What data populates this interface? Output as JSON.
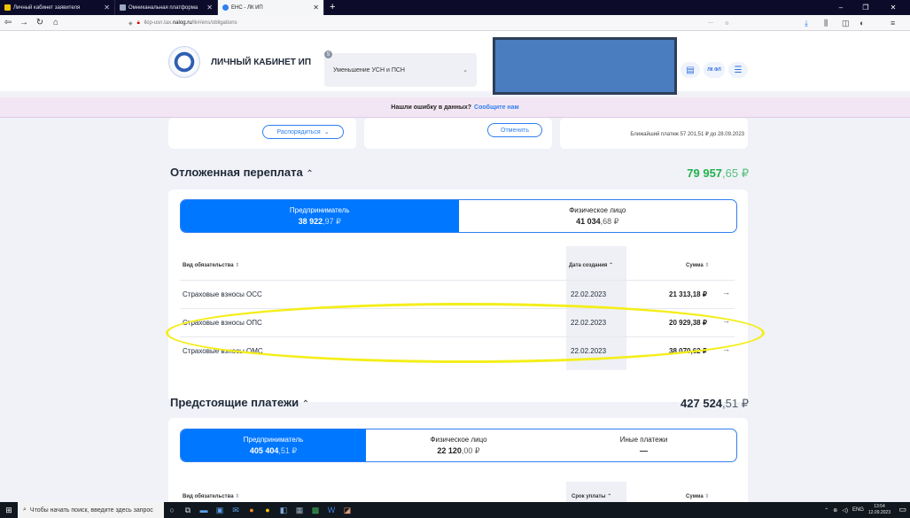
{
  "browser": {
    "tabs": [
      {
        "title": "Личный кабинет заявителя",
        "active": false
      },
      {
        "title": "Омниканальная платформа",
        "active": false
      },
      {
        "title": "ЕНС - ЛК ИП",
        "active": true
      }
    ],
    "new_tab": "+",
    "url_prefix": "lkip-usn.tax.",
    "url_domain": "nalog.ru",
    "url_path": "/lk#/ens/obligations",
    "url_more": "···",
    "window_min": "–",
    "window_max": "❐",
    "window_close": "✕"
  },
  "header": {
    "brand": "ЛИЧНЫЙ КАБИНЕТ ИП",
    "mode_select": "Уменьшение УСН и ПСН",
    "mode_badge": "5",
    "lk_fl": "ЛК ФЛ"
  },
  "banner": {
    "text": "Нашли ошибку в данных?",
    "link": "Сообщите нам"
  },
  "top_cards": {
    "dispose_button": "Распорядиться",
    "cancel_button": "Отменить",
    "next_payment": "Ближайший платеж 57 201,51 ₽ до 28.09.2023"
  },
  "deferred": {
    "title": "Отложенная переплата",
    "amount_int": "79 957",
    "amount_frac": ",65 ₽",
    "amount_color": "#22b04b",
    "segments": [
      {
        "label": "Предприниматель",
        "int": "38 922",
        "frac": ",97 ₽",
        "active": true
      },
      {
        "label": "Физическое лицо",
        "int": "41 034",
        "frac": ",68 ₽",
        "active": false
      }
    ],
    "columns": [
      "Вид обязательства",
      "Дата создания",
      "Сумма"
    ],
    "rows": [
      {
        "name": "Страховые взносы ОСС",
        "date": "22.02.2023",
        "sum": "21 313,18 ₽"
      },
      {
        "name": "Страховые взносы ОПС",
        "date": "22.02.2023",
        "sum": "20 929,38 ₽"
      },
      {
        "name": "Страховые взносы ОМС",
        "date": "22.02.2023",
        "sum": "38 070,62 ₽"
      }
    ]
  },
  "upcoming": {
    "title": "Предстоящие платежи",
    "amount_int": "427 524",
    "amount_frac": ",51 ₽",
    "segments": [
      {
        "label": "Предприниматель",
        "int": "405 404",
        "frac": ",51 ₽",
        "active": true
      },
      {
        "label": "Физическое лицо",
        "int": "22 120",
        "frac": ",00 ₽",
        "active": false
      },
      {
        "label": "Иные платежи",
        "int": "—",
        "frac": "",
        "active": false
      }
    ],
    "columns": [
      "Вид обязательства",
      "Срок уплаты",
      "Сумма"
    ]
  },
  "taskbar": {
    "search_placeholder": "Чтобы начать поиск, введите здесь запрос",
    "lang": "ENG",
    "time": "13:54",
    "date": "12.09.2023"
  }
}
